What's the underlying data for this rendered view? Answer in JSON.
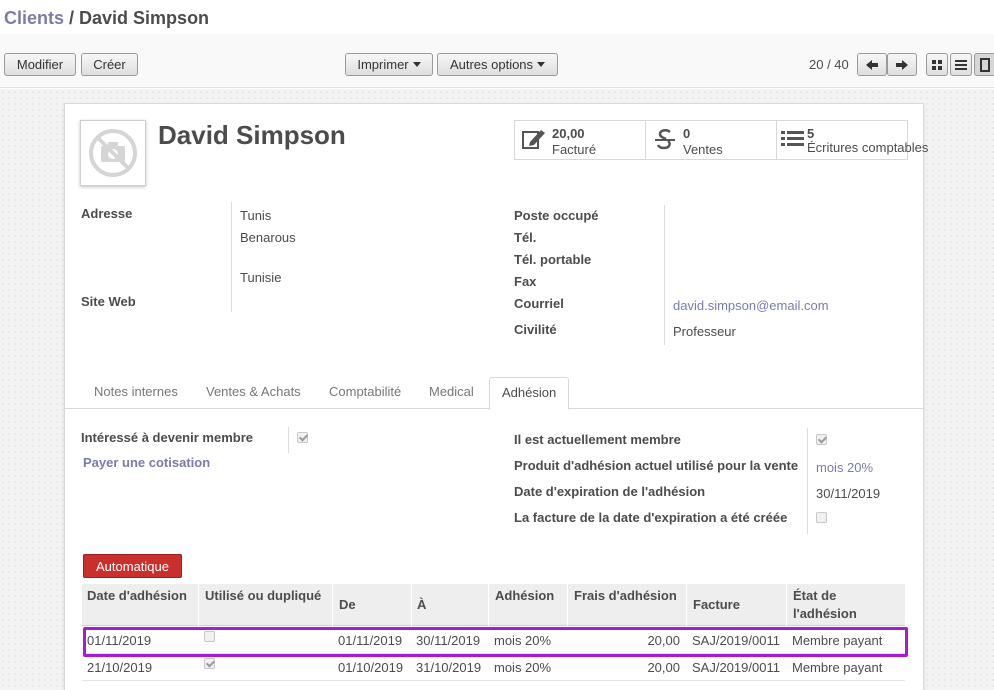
{
  "breadcrumb": {
    "parent": "Clients",
    "separator": " / ",
    "current": "David Simpson"
  },
  "toolbar": {
    "edit_label": "Modifier",
    "create_label": "Créer",
    "print_label": "Imprimer",
    "more_label": "Autres options",
    "pager": "20 / 40",
    "prev_icon": "arrow-left-icon",
    "next_icon": "arrow-right-icon",
    "views": [
      "kanban-view-icon",
      "list-view-icon",
      "form-view-icon"
    ]
  },
  "partner": {
    "name": "David Simpson",
    "avatar_icon": "no-photo-camera-icon"
  },
  "stats": [
    {
      "value": "20,00",
      "label": "Facturé",
      "icon": "edit-invoice-icon"
    },
    {
      "value": "0",
      "label": "Ventes",
      "icon": "strikethrough-s-icon"
    },
    {
      "value": "5",
      "label": "Écritures comptables",
      "icon": "list-icon"
    }
  ],
  "address": {
    "label": "Adresse",
    "line1": "Tunis",
    "line2": "Benarous",
    "country": "Tunisie",
    "website_label": "Site Web"
  },
  "contact": {
    "job_label": "Poste occupé",
    "phone_label": "Tél.",
    "mobile_label": "Tél. portable",
    "fax_label": "Fax",
    "email_label": "Courriel",
    "email": "david.simpson@email.com",
    "title_label": "Civilité",
    "title": "Professeur"
  },
  "tabs": [
    {
      "label": "Notes internes",
      "active": false
    },
    {
      "label": "Ventes & Achats",
      "active": false
    },
    {
      "label": "Comptabilité",
      "active": false
    },
    {
      "label": "Medical",
      "active": false
    },
    {
      "label": "Adhésion",
      "active": true
    }
  ],
  "membership": {
    "interested_label": "Intéressé à devenir membre",
    "interested": true,
    "pay_link": "Payer une cotisation",
    "current_member_label": "Il est actuellement membre",
    "current_member": true,
    "product_label": "Produit d'adhésion actuel utilisé pour la vente",
    "product": "mois 20%",
    "expiry_label": "Date d'expiration de l'adhésion",
    "expiry": "30/11/2019",
    "invoice_created_label": "La facture de la date d'expiration a été créée",
    "invoice_created": false,
    "auto_button": "Automatique"
  },
  "grid": {
    "columns": [
      "Date d'adhésion",
      "Utilisé ou dupliqué",
      "De",
      "À",
      "Adhésion",
      "Frais d'adhésion",
      "Facture",
      "État de l'adhésion"
    ],
    "rows": [
      {
        "date": "01/11/2019",
        "used": false,
        "from": "01/11/2019",
        "to": "30/11/2019",
        "product": "mois 20%",
        "fee": "20,00",
        "invoice": "SAJ/2019/0011",
        "state": "Membre payant"
      },
      {
        "date": "21/10/2019",
        "used": true,
        "from": "01/10/2019",
        "to": "31/10/2019",
        "product": "mois 20%",
        "fee": "20,00",
        "invoice": "SAJ/2019/0011",
        "state": "Membre payant"
      }
    ]
  },
  "colors": {
    "link": "#7c7bad",
    "primary_button": "#c9302c",
    "highlight": "#a61bd6"
  }
}
